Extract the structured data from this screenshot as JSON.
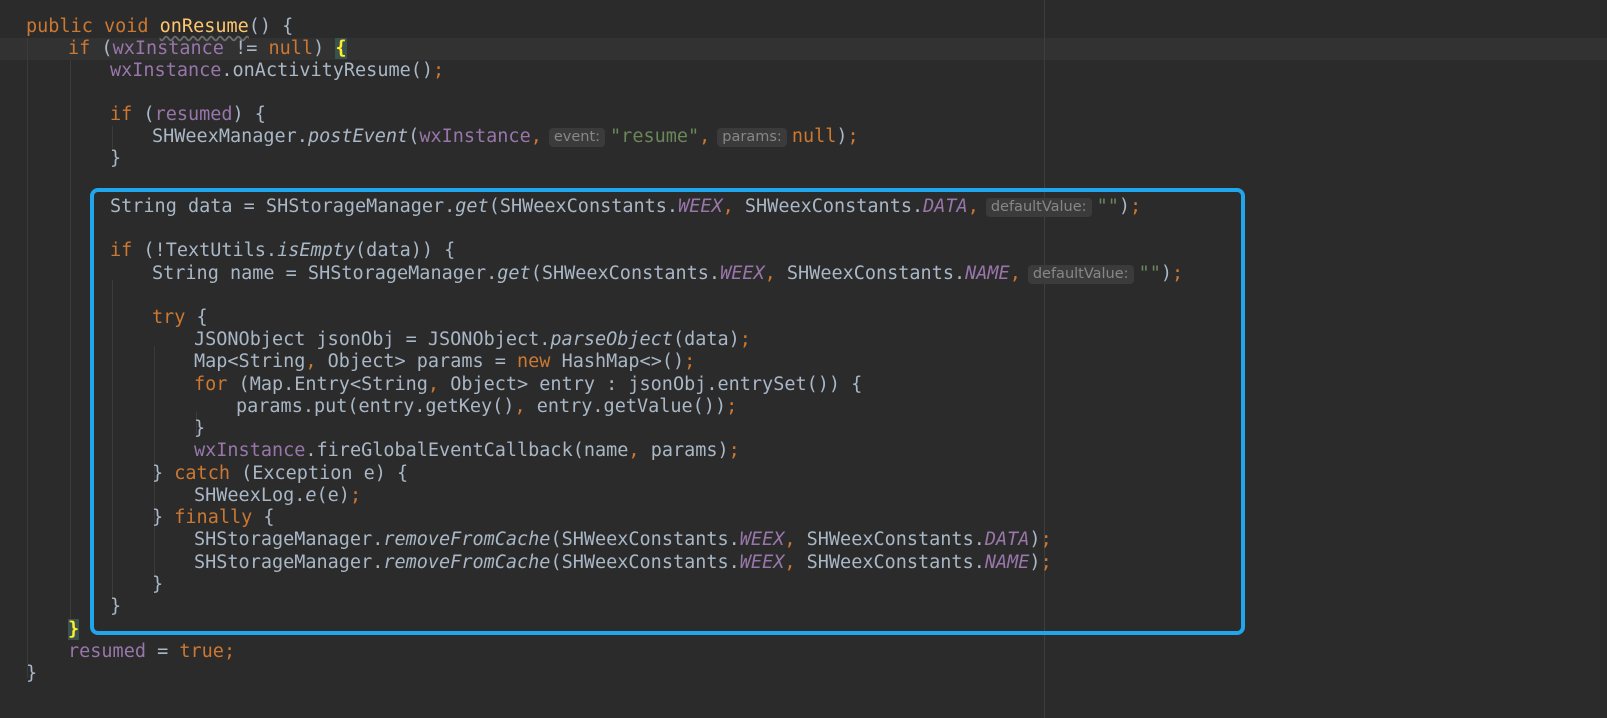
{
  "editor": {
    "hints": {
      "event": "event:",
      "params": "params:",
      "default_value": "defaultValue:"
    },
    "lines": {
      "l1": {
        "a": "public void ",
        "b": "onResume",
        "c": "() {"
      },
      "l2": {
        "a": "if",
        "b": " (",
        "c": "wxInstance",
        "d": " != ",
        "e": "null",
        "f": ") ",
        "g": "{"
      },
      "l3": {
        "a": "wxInstance",
        "b": ".onActivityResume()",
        "c": ";"
      },
      "l5": {
        "a": "if",
        "b": " (",
        "c": "resumed",
        "d": ") {"
      },
      "l6": {
        "a": "SHWeexManager.",
        "b": "postEvent",
        "c": "(",
        "d": "wxInstance",
        "e": ",",
        "f": "\"resume\"",
        "g": ",",
        "h": "null",
        "i": ")",
        "j": ";"
      },
      "l7": {
        "a": "}"
      },
      "l9": {
        "a": "String data = SHStorageManager.",
        "b": "get",
        "c": "(SHWeexConstants.",
        "d": "WEEX",
        "e": ", ",
        "f": "SHWeexConstants.",
        "g": "DATA",
        "h": ",",
        "i": "\"\"",
        "j": ")",
        "k": ";"
      },
      "l11": {
        "a": "if",
        "b": " (!TextUtils.",
        "c": "isEmpty",
        "d": "(data)) {"
      },
      "l12": {
        "a": "String name = SHStorageManager.",
        "b": "get",
        "c": "(SHWeexConstants.",
        "d": "WEEX",
        "e": ", ",
        "f": "SHWeexConstants.",
        "g": "NAME",
        "h": ",",
        "i": "\"\"",
        "j": ")",
        "k": ";"
      },
      "l14": {
        "a": "try",
        "b": " {"
      },
      "l15": {
        "a": "JSONObject jsonObj = JSONObject.",
        "b": "parseObject",
        "c": "(data)",
        "d": ";"
      },
      "l16": {
        "a": "Map<String",
        "b": ", ",
        "c": "Object> params = ",
        "d": "new",
        "e": " HashMap<>()",
        "f": ";"
      },
      "l17": {
        "a": "for",
        "b": " (Map.Entry<String",
        "c": ", ",
        "d": "Object> entry : jsonObj.entrySet()) {"
      },
      "l18": {
        "a": "params.put(entry.getKey()",
        "b": ", ",
        "c": "entry.getValue())",
        "d": ";"
      },
      "l19": {
        "a": "}"
      },
      "l20": {
        "a": "wxInstance",
        "b": ".fireGlobalEventCallback(name",
        "c": ", ",
        "d": "params)",
        "e": ";"
      },
      "l21": {
        "a": "} ",
        "b": "catch",
        "c": " (Exception e) {"
      },
      "l22": {
        "a": "SHWeexLog.",
        "b": "e",
        "c": "(e)",
        "d": ";"
      },
      "l23": {
        "a": "} ",
        "b": "finally",
        "c": " {"
      },
      "l24": {
        "a": "SHStorageManager.",
        "b": "removeFromCache",
        "c": "(SHWeexConstants.",
        "d": "WEEX",
        "e": ", ",
        "f": "SHWeexConstants.",
        "g": "DATA",
        "h": ")",
        "i": ";"
      },
      "l25": {
        "a": "SHStorageManager.",
        "b": "removeFromCache",
        "c": "(SHWeexConstants.",
        "d": "WEEX",
        "e": ", ",
        "f": "SHWeexConstants.",
        "g": "NAME",
        "h": ")",
        "i": ";"
      },
      "l26": {
        "a": "}"
      },
      "l27": {
        "a": "}"
      },
      "l28": {
        "a": "}"
      },
      "l29": {
        "a": "resumed",
        "b": " = ",
        "c": "true",
        "d": ";"
      },
      "l30": {
        "a": "}"
      }
    },
    "colors": {
      "background": "#2b2b2b",
      "keyword": "#cc7832",
      "field": "#9876aa",
      "string": "#6a8759",
      "default_text": "#a9b7c6",
      "highlight_box": "#1fa6ec",
      "brace_match": "#ffef28"
    }
  }
}
